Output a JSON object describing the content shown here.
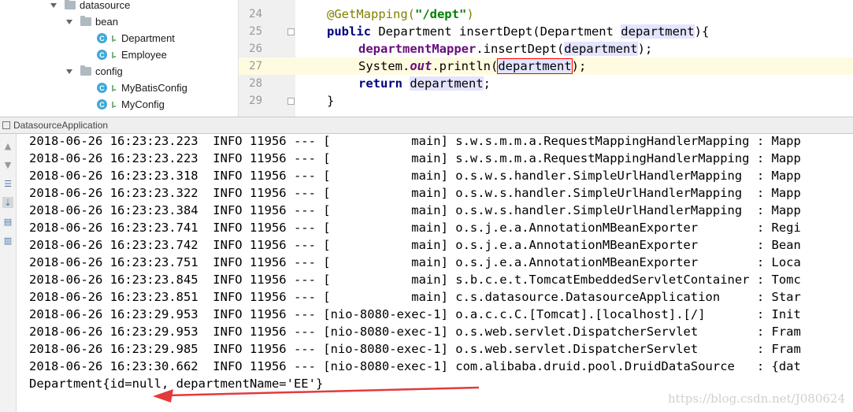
{
  "project_tree": {
    "items": [
      {
        "label": "datasource",
        "type": "folder",
        "indent": 0,
        "expanded": true
      },
      {
        "label": "bean",
        "type": "folder",
        "indent": 1,
        "expanded": true
      },
      {
        "label": "Department",
        "type": "class",
        "indent": 2
      },
      {
        "label": "Employee",
        "type": "class",
        "indent": 2
      },
      {
        "label": "config",
        "type": "folder",
        "indent": 1,
        "expanded": true
      },
      {
        "label": "MyBatisConfig",
        "type": "class",
        "indent": 2
      },
      {
        "label": "MyConfig",
        "type": "class",
        "indent": 2
      }
    ],
    "class_badge": "C"
  },
  "editor": {
    "lines": [
      {
        "num": "24",
        "annotation": "@GetMapping(",
        "string": "\"/dept\"",
        "close": ")"
      },
      {
        "num": "25",
        "kw": "public",
        "sig_a": " Department insertDept(Department ",
        "param": "department",
        "sig_b": "){"
      },
      {
        "num": "26",
        "field": "departmentMapper",
        "call": ".insertDept(",
        "param": "department",
        "end": ");"
      },
      {
        "num": "27",
        "sys": "System.",
        "out": "out",
        "call": ".println(",
        "param": "department",
        "end": ");"
      },
      {
        "num": "28",
        "kw": "return",
        "sp": " ",
        "param": "department",
        "end": ";"
      },
      {
        "num": "29",
        "text": "}"
      }
    ]
  },
  "run_panel": {
    "title": "DatasourceApplication",
    "log_lines": [
      "2018-06-26 16:23:23.223  INFO 11956 --- [           main] s.w.s.m.m.a.RequestMappingHandlerMapping : Mapp",
      "2018-06-26 16:23:23.223  INFO 11956 --- [           main] s.w.s.m.m.a.RequestMappingHandlerMapping : Mapp",
      "2018-06-26 16:23:23.318  INFO 11956 --- [           main] o.s.w.s.handler.SimpleUrlHandlerMapping  : Mapp",
      "2018-06-26 16:23:23.322  INFO 11956 --- [           main] o.s.w.s.handler.SimpleUrlHandlerMapping  : Mapp",
      "2018-06-26 16:23:23.384  INFO 11956 --- [           main] o.s.w.s.handler.SimpleUrlHandlerMapping  : Mapp",
      "2018-06-26 16:23:23.741  INFO 11956 --- [           main] o.s.j.e.a.AnnotationMBeanExporter        : Regi",
      "2018-06-26 16:23:23.742  INFO 11956 --- [           main] o.s.j.e.a.AnnotationMBeanExporter        : Bean",
      "2018-06-26 16:23:23.751  INFO 11956 --- [           main] o.s.j.e.a.AnnotationMBeanExporter        : Loca",
      "2018-06-26 16:23:23.845  INFO 11956 --- [           main] s.b.c.e.t.TomcatEmbeddedServletContainer : Tomc",
      "2018-06-26 16:23:23.851  INFO 11956 --- [           main] c.s.datasource.DatasourceApplication     : Star",
      "2018-06-26 16:23:29.953  INFO 11956 --- [nio-8080-exec-1] o.a.c.c.C.[Tomcat].[localhost].[/]       : Init",
      "2018-06-26 16:23:29.953  INFO 11956 --- [nio-8080-exec-1] o.s.web.servlet.DispatcherServlet        : Fram",
      "2018-06-26 16:23:29.985  INFO 11956 --- [nio-8080-exec-1] o.s.web.servlet.DispatcherServlet        : Fram",
      "2018-06-26 16:23:30.662  INFO 11956 --- [nio-8080-exec-1] com.alibaba.druid.pool.DruidDataSource   : {dat"
    ],
    "result_line": "Department{id=null, departmentName='EE'}"
  },
  "watermark": "https://blog.csdn.net/J080624",
  "colors": {
    "arrow": "#e23b3b",
    "console_highlight_box": "#ff0000"
  }
}
